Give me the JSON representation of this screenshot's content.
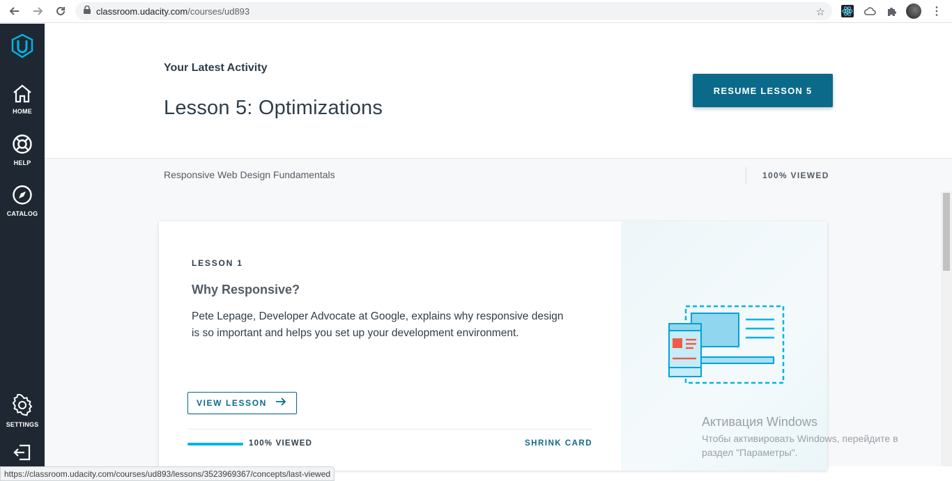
{
  "browser": {
    "url_host": "classroom.udacity.com",
    "url_path": "/courses/ud893",
    "status_url": "https://classroom.udacity.com/courses/ud893/lessons/3523969367/concepts/last-viewed"
  },
  "sidebar": {
    "items": [
      {
        "label": "HOME",
        "icon": "home-icon"
      },
      {
        "label": "HELP",
        "icon": "lifebuoy-icon"
      },
      {
        "label": "CATALOG",
        "icon": "compass-icon"
      },
      {
        "label": "SETTINGS",
        "icon": "gear-icon"
      }
    ]
  },
  "header": {
    "eyebrow": "Your Latest Activity",
    "lesson_title": "Lesson 5: Optimizations",
    "resume_label": "RESUME LESSON 5"
  },
  "subbar": {
    "course_name": "Responsive Web Design Fundamentals",
    "viewed": "100% VIEWED"
  },
  "card": {
    "lesson_number": "LESSON 1",
    "lesson_name": "Why Responsive?",
    "description": "Pete Lepage, Developer Advocate at Google, explains why responsive design is so important and helps you set up your development environment.",
    "view_label": "VIEW LESSON",
    "progress_percent": 100,
    "viewed_label": "100% VIEWED",
    "shrink_label": "SHRINK CARD"
  },
  "watermark": {
    "title": "Активация Windows",
    "subtitle": "Чтобы активировать Windows, перейдите в раздел \"Параметры\"."
  },
  "colors": {
    "sidebar_bg": "#1f2832",
    "brand_teal": "#0b6a8a",
    "udacity_blue": "#02b3e4"
  }
}
